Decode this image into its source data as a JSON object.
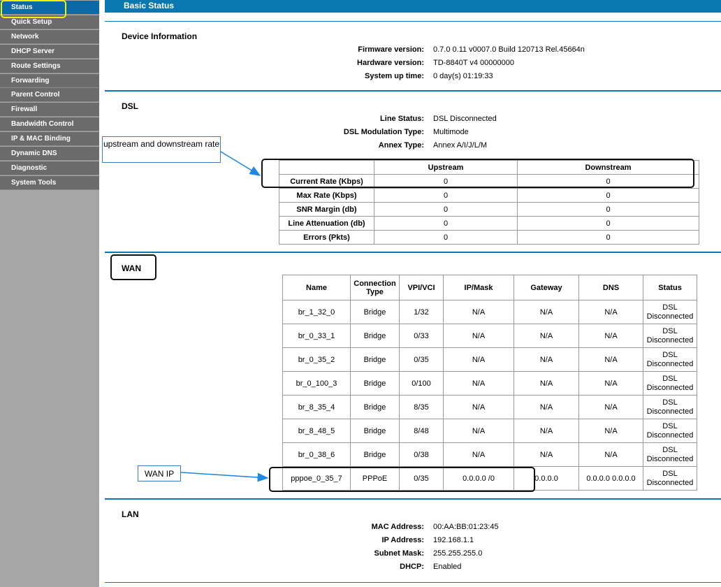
{
  "sidebar": {
    "items": [
      {
        "label": "Status"
      },
      {
        "label": "Quick Setup"
      },
      {
        "label": "Network"
      },
      {
        "label": "DHCP Server"
      },
      {
        "label": "Route Settings"
      },
      {
        "label": "Forwarding"
      },
      {
        "label": "Parent Control"
      },
      {
        "label": "Firewall"
      },
      {
        "label": "Bandwidth Control"
      },
      {
        "label": "IP & MAC Binding"
      },
      {
        "label": "Dynamic DNS"
      },
      {
        "label": "Diagnostic"
      },
      {
        "label": "System Tools"
      }
    ]
  },
  "header": {
    "title": "Basic Status"
  },
  "device": {
    "title": "Device Information",
    "firmware_label": "Firmware version:",
    "firmware_value": "0.7.0 0.11 v0007.0 Build 120713 Rel.45664n",
    "hardware_label": "Hardware version:",
    "hardware_value": "TD-8840T v4 00000000",
    "uptime_label": "System up time:",
    "uptime_value": "0 day(s) 01:19:33"
  },
  "dsl": {
    "title": "DSL",
    "line_status_label": "Line Status:",
    "line_status_value": "DSL Disconnected",
    "modulation_label": "DSL Modulation Type:",
    "modulation_value": "Multimode",
    "annex_label": "Annex Type:",
    "annex_value": "Annex A/I/J/L/M",
    "headers": [
      "",
      "Upstream",
      "Downstream"
    ],
    "rows": [
      [
        "Current Rate (Kbps)",
        "0",
        "0"
      ],
      [
        "Max Rate (Kbps)",
        "0",
        "0"
      ],
      [
        "SNR Margin (db)",
        "0",
        "0"
      ],
      [
        "Line Attenuation (db)",
        "0",
        "0"
      ],
      [
        "Errors (Pkts)",
        "0",
        "0"
      ]
    ]
  },
  "wan": {
    "title": "WAN",
    "headers": [
      "Name",
      "Connection Type",
      "VPI/VCI",
      "IP/Mask",
      "Gateway",
      "DNS",
      "Status"
    ],
    "rows": [
      [
        "br_1_32_0",
        "Bridge",
        "1/32",
        "N/A",
        "N/A",
        "N/A",
        "DSL Disconnected"
      ],
      [
        "br_0_33_1",
        "Bridge",
        "0/33",
        "N/A",
        "N/A",
        "N/A",
        "DSL Disconnected"
      ],
      [
        "br_0_35_2",
        "Bridge",
        "0/35",
        "N/A",
        "N/A",
        "N/A",
        "DSL Disconnected"
      ],
      [
        "br_0_100_3",
        "Bridge",
        "0/100",
        "N/A",
        "N/A",
        "N/A",
        "DSL Disconnected"
      ],
      [
        "br_8_35_4",
        "Bridge",
        "8/35",
        "N/A",
        "N/A",
        "N/A",
        "DSL Disconnected"
      ],
      [
        "br_8_48_5",
        "Bridge",
        "8/48",
        "N/A",
        "N/A",
        "N/A",
        "DSL Disconnected"
      ],
      [
        "br_0_38_6",
        "Bridge",
        "0/38",
        "N/A",
        "N/A",
        "N/A",
        "DSL Disconnected"
      ],
      [
        "pppoe_0_35_7",
        "PPPoE",
        "0/35",
        "0.0.0.0 /0",
        "0.0.0.0",
        "0.0.0.0 0.0.0.0",
        "DSL Disconnected"
      ]
    ]
  },
  "lan": {
    "title": "LAN",
    "mac_label": "MAC Address:",
    "mac_value": "00:AA:BB:01:23:45",
    "ip_label": "IP Address:",
    "ip_value": "192.168.1.1",
    "mask_label": "Subnet Mask:",
    "mask_value": "255.255.255.0",
    "dhcp_label": "DHCP:",
    "dhcp_value": "Enabled"
  },
  "annotations": {
    "rate_note": "upstream and downstream rate",
    "wan_ip_note": "WAN IP"
  }
}
